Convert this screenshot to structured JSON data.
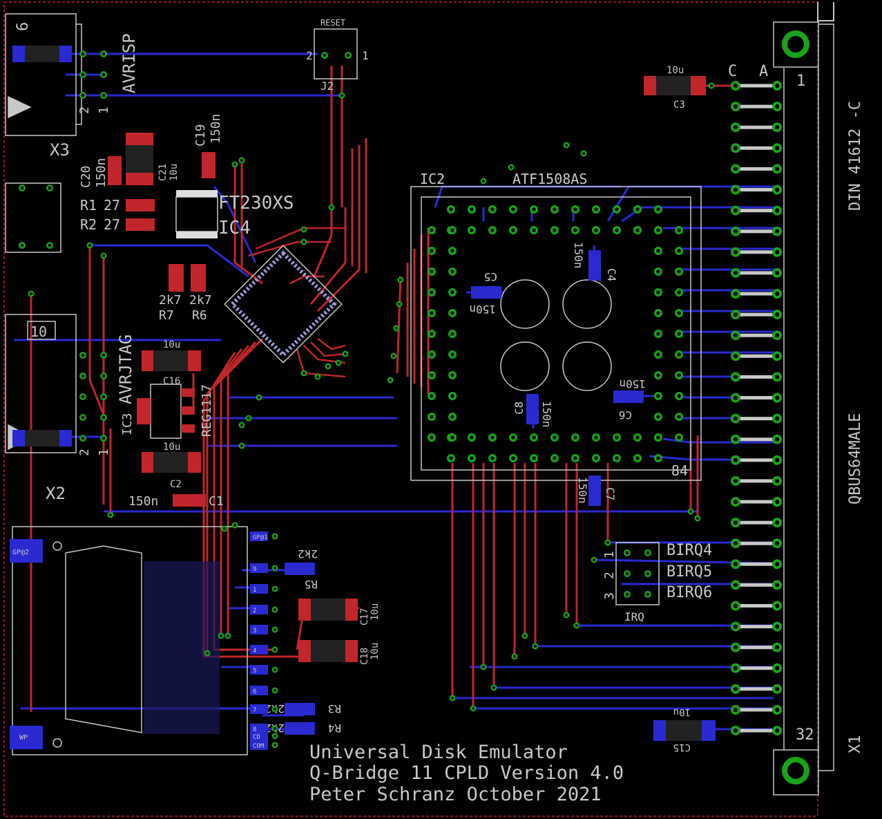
{
  "title": {
    "line1": "Universal Disk Emulator",
    "line2": "Q-Bridge 11 CPLD Version 4.0",
    "line3": "Peter Schranz October 2021"
  },
  "connector": {
    "col_c": "C",
    "col_a": "A",
    "pin_first": "1",
    "pin_last": "32",
    "standard": "DIN 41612 -C",
    "type": "QBUS64MALE",
    "ref": "X1"
  },
  "ic2": {
    "ref": "IC2",
    "part": "ATF1508AS",
    "pin84": "84"
  },
  "ic4": {
    "ref": "IC4",
    "part": "FT230XS"
  },
  "ic3": {
    "ref": "IC3",
    "part": "REG1117"
  },
  "x3": {
    "ref": "X3",
    "label": "AVRISP",
    "pin_num": "6",
    "pin2": "2",
    "pin1": "1"
  },
  "x2": {
    "ref": "X2",
    "label": "AVRJTAG",
    "pin_num": "10",
    "pin2": "2",
    "pin1": "1"
  },
  "reset": {
    "label": "RESET",
    "ref": "J2",
    "pin2": "2",
    "pin1": "1"
  },
  "irq": {
    "ref": "IRQ",
    "birq4": "BIRQ4",
    "birq5": "BIRQ5",
    "birq6": "BIRQ6",
    "n1": "1",
    "n2": "2",
    "n3": "3"
  },
  "caps": {
    "c1_val": "150n",
    "c1_ref": "C1",
    "c2_val": "10u",
    "c2_ref": "C2",
    "c3_val": "10u",
    "c3_ref": "C3",
    "c16_val": "10u",
    "c16_ref": "C16",
    "c17_val": "10u",
    "c17_ref": "C17",
    "c18_val": "10u",
    "c18_ref": "C18",
    "c19_val": "150n",
    "c19_ref": "C19",
    "c20_val": "150n",
    "c20_ref": "C20",
    "c21_val": "10u",
    "c21_ref": "C21",
    "c15_val": "10u",
    "c15_ref": "C15",
    "c4_val": "150n",
    "c4_ref": "C4",
    "c5_val": "150n",
    "c5_ref": "C5",
    "c6_val": "150n",
    "c6_ref": "C6",
    "c7_val": "150n",
    "c7_ref": "C7",
    "c8_val": "150n",
    "c8_ref": "C8"
  },
  "resistors": {
    "r1": "R1",
    "r1_val": "27",
    "r2": "R2",
    "r2_val": "27",
    "r6": "R6",
    "r6_val": "2k7",
    "r7": "R7",
    "r7_val": "2k7",
    "r3": "R3",
    "r3_val": "2k2",
    "r4": "R4",
    "r4_val": "2k2",
    "r5": "R5",
    "r5_val": "2k2"
  },
  "sd": {
    "pins": [
      "GP@1",
      "9",
      "1",
      "2",
      "3",
      "4",
      "5",
      "6",
      "7",
      "8",
      "CD",
      "COM"
    ],
    "gp2": "GP@2",
    "wp": "WP"
  },
  "colors": {
    "bg": "#000000",
    "top_copper": "#c0262c",
    "bottom_copper": "#2a2ad0",
    "pad": "#1aa31a",
    "silk": "#c8c8c8"
  }
}
